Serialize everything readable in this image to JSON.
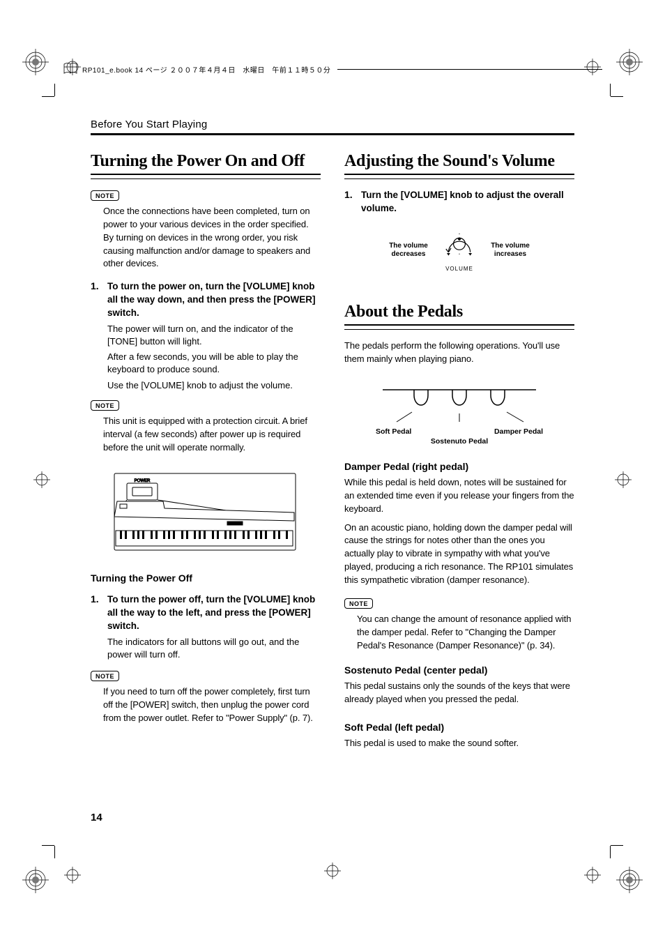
{
  "filebar": "RP101_e.book  14 ページ  ２００７年４月４日　水曜日　午前１１時５０分",
  "running_head": "Before You Start Playing",
  "left": {
    "h1": "Turning the Power On and Off",
    "note1": "NOTE",
    "note1_body": "Once the connections have been completed, turn on power to your various devices in the order specified. By turning on devices in the wrong order, you risk causing malfunction and/or damage to speakers and other devices.",
    "step1_num": "1.",
    "step1_bold": "To turn the power on, turn the [VOLUME] knob all the way down, and then press the [POWER] switch.",
    "step1_a": "The power will turn on, and the indicator of the [TONE] button will light.",
    "step1_b": "After a few seconds, you will be able to play the keyboard to produce sound.",
    "step1_c": "Use the [VOLUME] knob to adjust the volume.",
    "note2": "NOTE",
    "note2_body": "This unit is equipped with a protection circuit. A brief interval (a few seconds) after power up is required before the unit will operate normally.",
    "fig_label": "POWER",
    "sub_off": "Turning the Power Off",
    "stepoff_num": "1.",
    "stepoff_bold": "To turn the power off, turn the [VOLUME] knob all the way to the left, and press the [POWER] switch.",
    "stepoff_a": "The indicators for all buttons will go out, and the power will turn off.",
    "note3": "NOTE",
    "note3_body": "If you need to turn off the power completely, first turn off the [POWER] switch, then unplug the power cord from the power outlet. Refer to \"Power Supply\" (p. 7)."
  },
  "right": {
    "h1a": "Adjusting the Sound's Volume",
    "vol_step_num": "1.",
    "vol_step_bold": "Turn the [VOLUME] knob to adjust the overall volume.",
    "vol_dec": "The volume decreases",
    "vol_inc": "The volume increases",
    "vol_caption": "VOLUME",
    "h1b": "About the Pedals",
    "pedal_intro": "The pedals perform the following operations. You'll use them mainly when playing piano.",
    "soft": "Soft Pedal",
    "sost": "Sostenuto Pedal",
    "damp": "Damper Pedal",
    "damp_h": "Damper Pedal (right pedal)",
    "damp_p1": "While this pedal is held down, notes will be sustained for an extended time even if you release your fingers from the keyboard.",
    "damp_p2": "On an acoustic piano, holding down the damper pedal will cause the strings for notes other than the ones you actually play to vibrate in sympathy with what you've played, producing a rich resonance. The RP101 simulates this sympathetic vibration (damper resonance).",
    "note4": "NOTE",
    "note4_body": "You can change the amount of resonance applied with the damper pedal. Refer to \"Changing the Damper Pedal's Resonance (Damper Resonance)\" (p. 34).",
    "sost_h": "Sostenuto Pedal (center pedal)",
    "sost_p": "This pedal sustains only the sounds of the keys that were already played when you pressed the pedal.",
    "soft_h": "Soft Pedal (left pedal)",
    "soft_p": "This pedal is used to make the sound softer."
  },
  "page_num": "14"
}
